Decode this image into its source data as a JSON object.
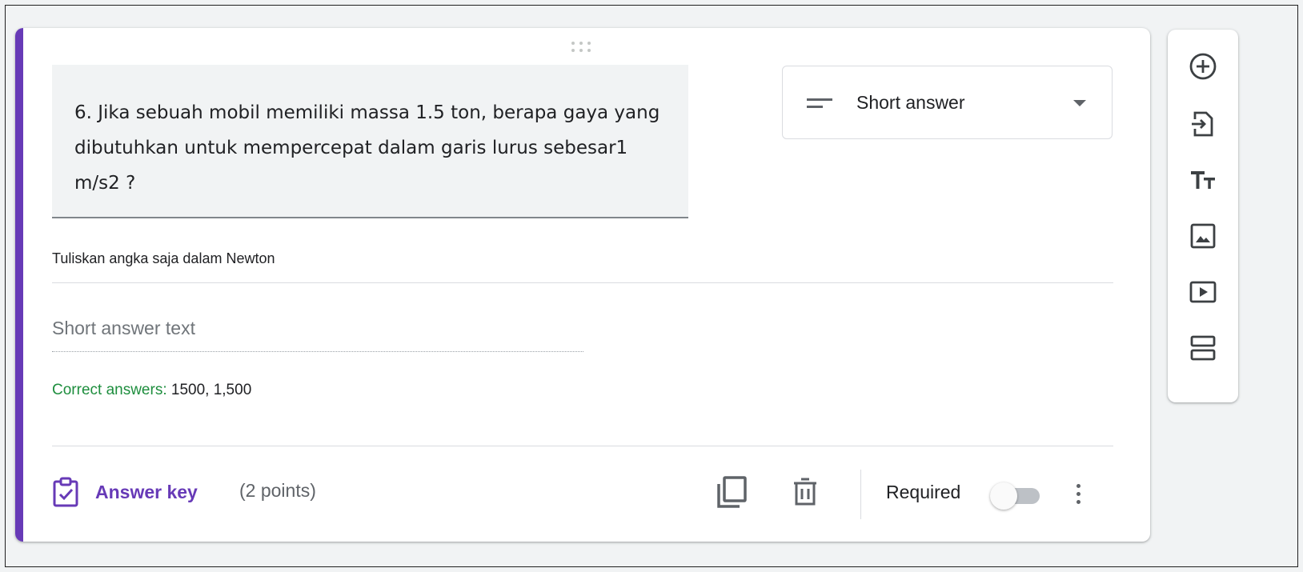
{
  "question": {
    "title": "6. Jika sebuah mobil memiliki massa 1.5 ton, berapa gaya yang dibutuhkan untuk mempercepat dalam garis lurus sebesar1 m/s2 ?",
    "type_label": "Short answer",
    "description": "Tuliskan angka saja dalam Newton",
    "answer_placeholder": "Short answer text",
    "correct_answers_label": "Correct answers:",
    "correct_answers_value": "1500, 1,500"
  },
  "footer": {
    "answer_key_label": "Answer key",
    "points": "(2 points)",
    "required_label": "Required",
    "required_on": false
  },
  "toolbar": {
    "items": [
      "add-question-icon",
      "import-questions-icon",
      "add-title-icon",
      "add-image-icon",
      "add-video-icon",
      "add-section-icon"
    ]
  },
  "colors": {
    "accent": "#673ab7",
    "correct": "#1e8e3e",
    "background": "#f1f3f4"
  }
}
